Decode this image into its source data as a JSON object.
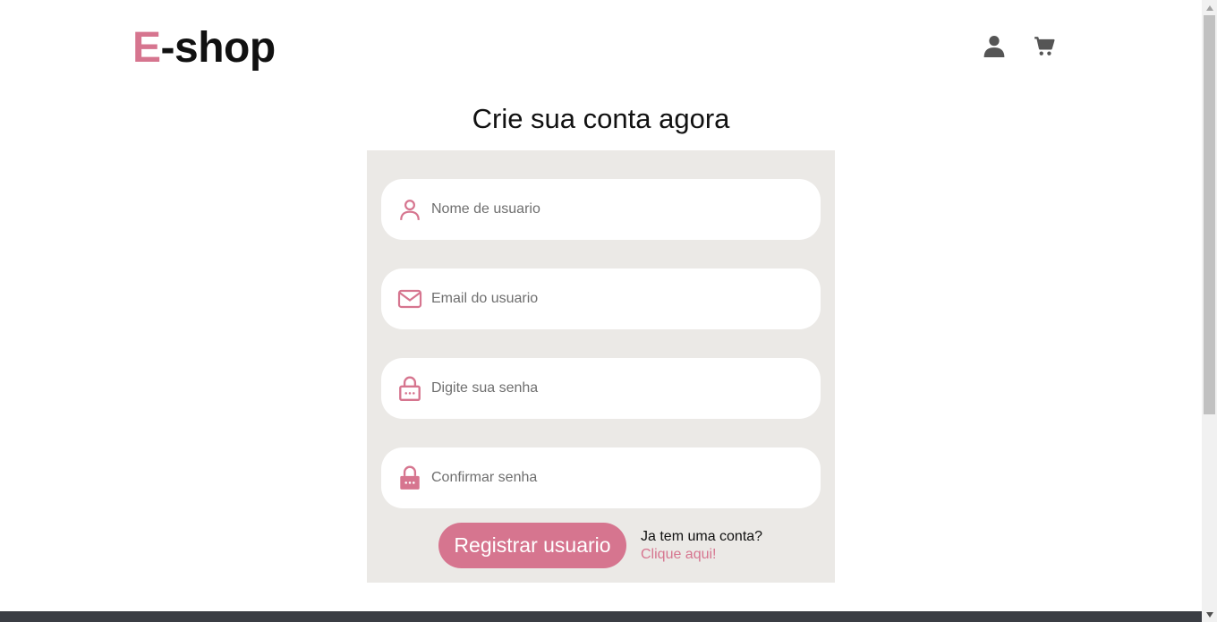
{
  "header": {
    "logo_letter": "E",
    "logo_rest": "-shop",
    "icons": [
      "user-icon",
      "cart-icon"
    ]
  },
  "main": {
    "title": "Crie sua conta agora",
    "fields": [
      {
        "placeholder": "Nome de usuario",
        "icon": "user-outline-icon"
      },
      {
        "placeholder": "Email do usuario",
        "icon": "envelope-icon"
      },
      {
        "placeholder": "Digite sua senha",
        "icon": "lock-outline-icon"
      },
      {
        "placeholder": "Confirmar senha",
        "icon": "lock-filled-icon"
      }
    ],
    "register_label": "Registrar usuario",
    "login_question": "Ja tem uma conta?",
    "login_link": "Clique aqui!"
  },
  "colors": {
    "accent": "#d6758f",
    "panel_bg": "#ebe9e6",
    "icon_gray": "#555555",
    "footer": "#3b3e44"
  }
}
